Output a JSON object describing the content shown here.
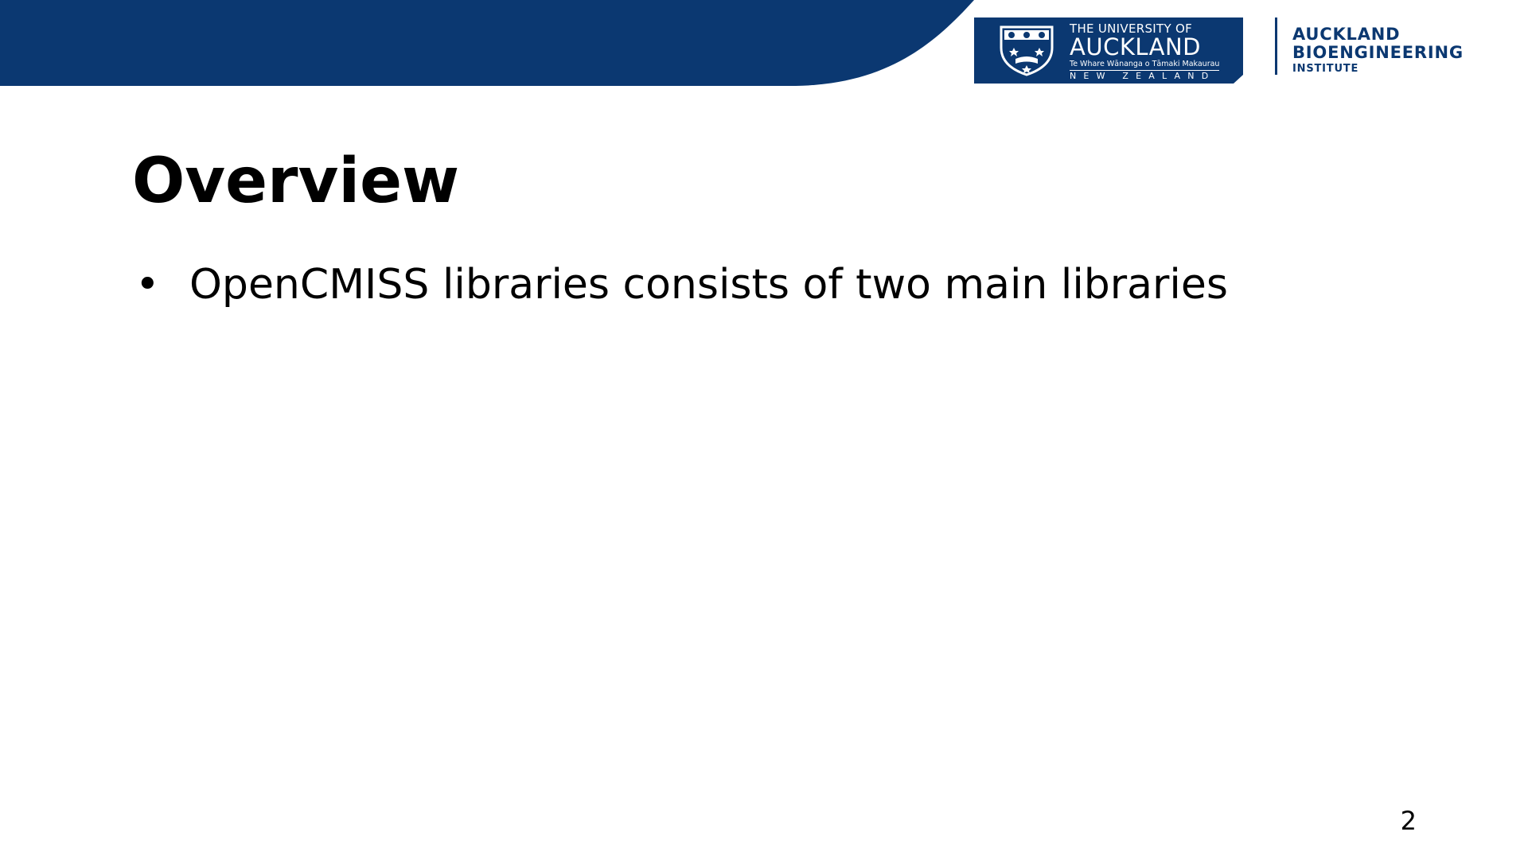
{
  "header": {
    "band_color": "#0b3871",
    "university_logo": {
      "line1": "THE UNIVERSITY OF",
      "line2": "AUCKLAND",
      "line3": "Te Whare Wānanga o Tāmaki Makaurau",
      "line4": "NEW ZEALAND",
      "crest_icon": "university-crest-icon"
    },
    "institute_logo": {
      "line1": "AUCKLAND",
      "line2": "BIOENGINEERING",
      "line3": "INSTITUTE",
      "color": "#0b3871"
    }
  },
  "slide": {
    "title": "Overview",
    "bullets": [
      {
        "marker": "•",
        "text": "OpenCMISS libraries consists of two main libraries"
      }
    ],
    "page_number": "2"
  }
}
